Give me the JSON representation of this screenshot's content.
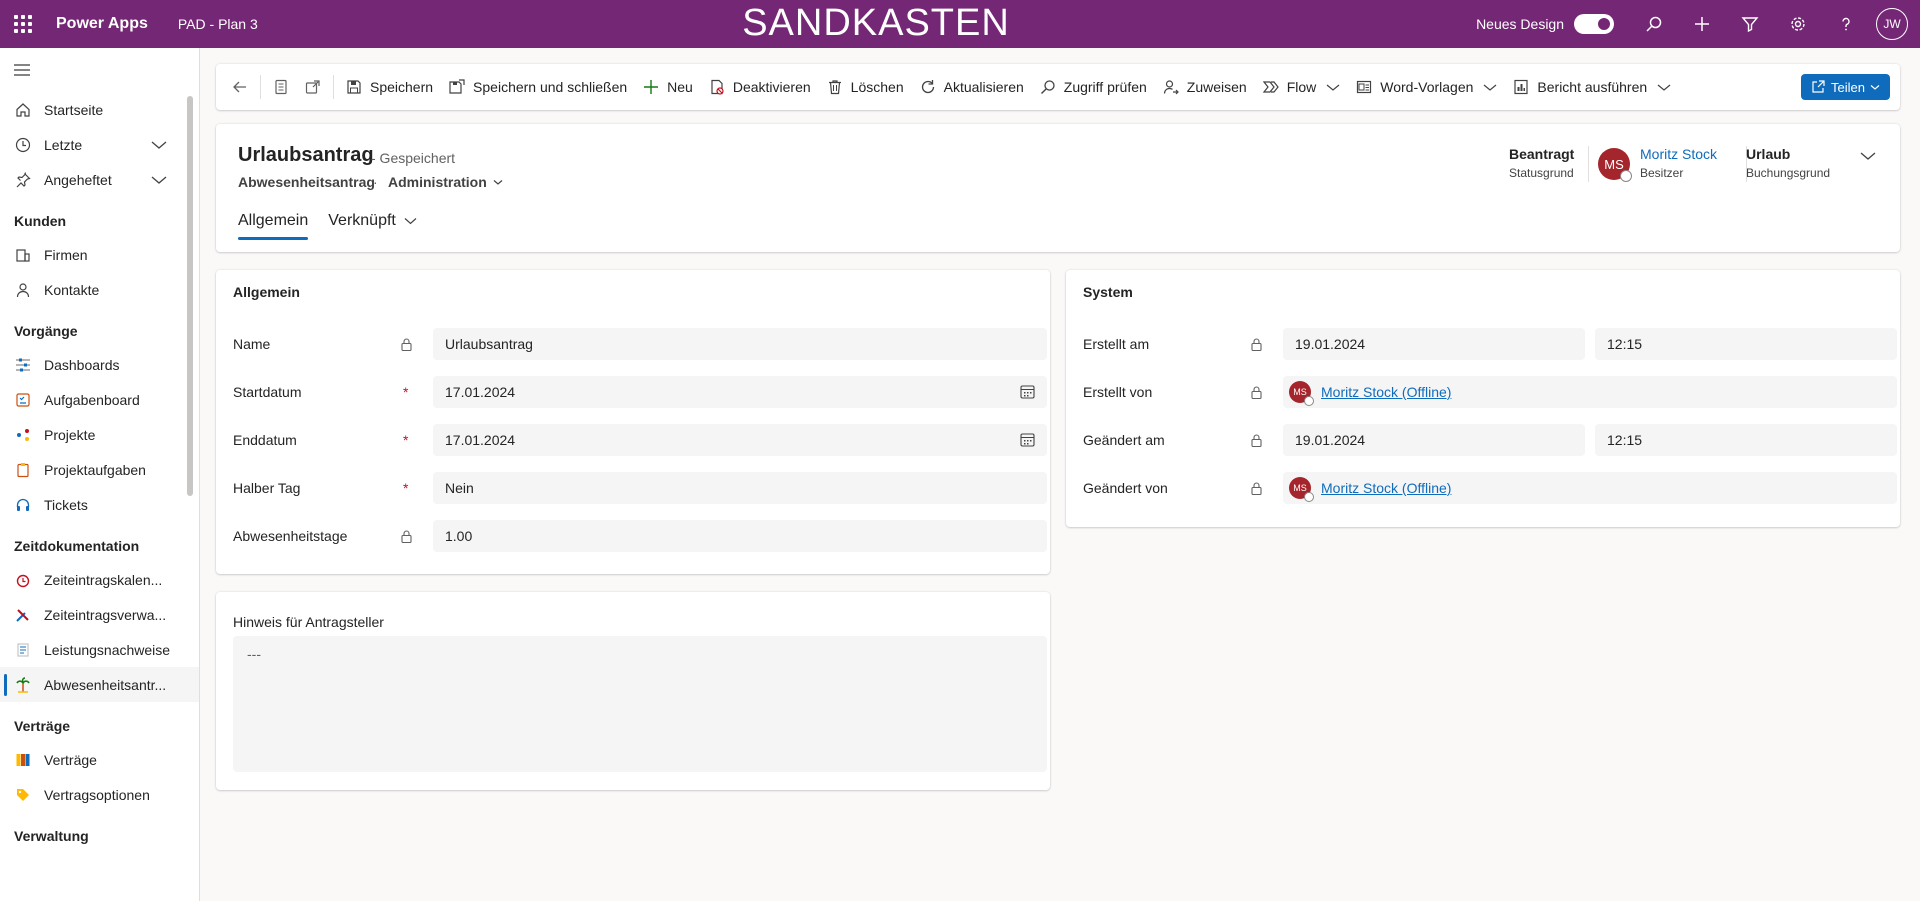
{
  "topbar": {
    "app_name": "Power Apps",
    "environment": "PAD - Plan 3",
    "banner": "SANDKASTEN",
    "new_design_label": "Neues Design",
    "new_design_on": true,
    "user_initials": "JW"
  },
  "sidebar": {
    "items_top": [
      {
        "label": "Startseite",
        "icon": "home-icon"
      },
      {
        "label": "Letzte",
        "icon": "clock-icon",
        "expandable": true
      },
      {
        "label": "Angeheftet",
        "icon": "pin-icon",
        "expandable": true
      }
    ],
    "groups": [
      {
        "title": "Kunden",
        "items": [
          {
            "label": "Firmen",
            "icon": "building-icon"
          },
          {
            "label": "Kontakte",
            "icon": "person-icon"
          }
        ]
      },
      {
        "title": "Vorgänge",
        "items": [
          {
            "label": "Dashboards",
            "icon": "dashboard-icon"
          },
          {
            "label": "Aufgabenboard",
            "icon": "taskboard-icon"
          },
          {
            "label": "Projekte",
            "icon": "project-icon"
          },
          {
            "label": "Projektaufgaben",
            "icon": "clipboard-icon"
          },
          {
            "label": "Tickets",
            "icon": "headset-icon"
          }
        ]
      },
      {
        "title": "Zeitdokumentation",
        "items": [
          {
            "label": "Zeiteintragskalen...",
            "icon": "alarm-clock-icon"
          },
          {
            "label": "Zeiteintragsverwa...",
            "icon": "tools-icon"
          },
          {
            "label": "Leistungsnachweise",
            "icon": "list-icon"
          },
          {
            "label": "Abwesenheitsantr...",
            "icon": "palm-tree-icon",
            "active": true
          }
        ]
      },
      {
        "title": "Verträge",
        "items": [
          {
            "label": "Verträge",
            "icon": "contract-icon"
          },
          {
            "label": "Vertragsoptionen",
            "icon": "tag-icon"
          }
        ]
      },
      {
        "title": "Verwaltung",
        "items": []
      }
    ]
  },
  "commands": {
    "save": "Speichern",
    "save_close": "Speichern und schließen",
    "new": "Neu",
    "deactivate": "Deaktivieren",
    "delete": "Löschen",
    "refresh": "Aktualisieren",
    "check_access": "Zugriff prüfen",
    "assign": "Zuweisen",
    "flow": "Flow",
    "word_templates": "Word-Vorlagen",
    "run_report": "Bericht ausführen",
    "share": "Teilen"
  },
  "header": {
    "title": "Urlaubsantrag",
    "saved_state": "- Gespeichert",
    "entity": "Abwesenheitsantrag",
    "separator": "·",
    "form_name": "Administration",
    "status_value": "Beantragt",
    "status_label": "Statusgrund",
    "owner_initials": "MS",
    "owner_name": "Moritz Stock",
    "owner_label": "Besitzer",
    "booking_value": "Urlaub",
    "booking_label": "Buchungsgrund",
    "tabs": [
      {
        "label": "Allgemein",
        "active": true
      },
      {
        "label": "Verknüpft",
        "active": false
      }
    ]
  },
  "general": {
    "title": "Allgemein",
    "fields": [
      {
        "label": "Name",
        "marker": "lock",
        "value": "Urlaubsantrag"
      },
      {
        "label": "Startdatum",
        "marker": "*",
        "value": "17.01.2024",
        "calendar": true
      },
      {
        "label": "Enddatum",
        "marker": "*",
        "value": "17.01.2024",
        "calendar": true
      },
      {
        "label": "Halber Tag",
        "marker": "*",
        "value": "Nein"
      },
      {
        "label": "Abwesenheitstage",
        "marker": "lock",
        "value": "1.00"
      }
    ]
  },
  "notes": {
    "label": "Hinweis für Antragsteller",
    "value": "---"
  },
  "system": {
    "title": "System",
    "created_on_label": "Erstellt am",
    "created_on_date": "19.01.2024",
    "created_on_time": "12:15",
    "created_by_label": "Erstellt von",
    "created_by_initials": "MS",
    "created_by_value": "Moritz Stock (Offline)",
    "modified_on_label": "Geändert am",
    "modified_on_date": "19.01.2024",
    "modified_on_time": "12:15",
    "modified_by_label": "Geändert von",
    "modified_by_initials": "MS",
    "modified_by_value": "Moritz Stock (Offline)"
  },
  "colors": {
    "brand": "#742774",
    "accent": "#0f6cbd",
    "required": "#c50f1f",
    "avatar": "#a4262c"
  }
}
